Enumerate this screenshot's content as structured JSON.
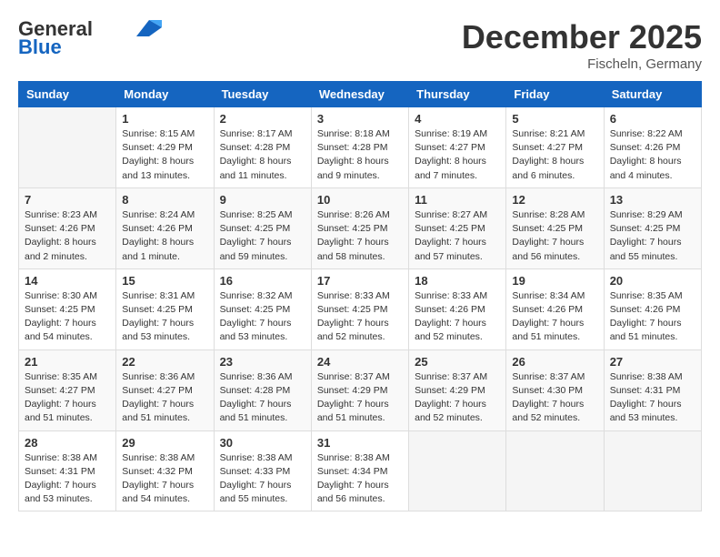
{
  "header": {
    "logo_general": "General",
    "logo_blue": "Blue",
    "month_title": "December 2025",
    "location": "Fischeln, Germany"
  },
  "weekdays": [
    "Sunday",
    "Monday",
    "Tuesday",
    "Wednesday",
    "Thursday",
    "Friday",
    "Saturday"
  ],
  "weeks": [
    [
      {
        "day": "",
        "info": ""
      },
      {
        "day": "1",
        "info": "Sunrise: 8:15 AM\nSunset: 4:29 PM\nDaylight: 8 hours\nand 13 minutes."
      },
      {
        "day": "2",
        "info": "Sunrise: 8:17 AM\nSunset: 4:28 PM\nDaylight: 8 hours\nand 11 minutes."
      },
      {
        "day": "3",
        "info": "Sunrise: 8:18 AM\nSunset: 4:28 PM\nDaylight: 8 hours\nand 9 minutes."
      },
      {
        "day": "4",
        "info": "Sunrise: 8:19 AM\nSunset: 4:27 PM\nDaylight: 8 hours\nand 7 minutes."
      },
      {
        "day": "5",
        "info": "Sunrise: 8:21 AM\nSunset: 4:27 PM\nDaylight: 8 hours\nand 6 minutes."
      },
      {
        "day": "6",
        "info": "Sunrise: 8:22 AM\nSunset: 4:26 PM\nDaylight: 8 hours\nand 4 minutes."
      }
    ],
    [
      {
        "day": "7",
        "info": "Sunrise: 8:23 AM\nSunset: 4:26 PM\nDaylight: 8 hours\nand 2 minutes."
      },
      {
        "day": "8",
        "info": "Sunrise: 8:24 AM\nSunset: 4:26 PM\nDaylight: 8 hours\nand 1 minute."
      },
      {
        "day": "9",
        "info": "Sunrise: 8:25 AM\nSunset: 4:25 PM\nDaylight: 7 hours\nand 59 minutes."
      },
      {
        "day": "10",
        "info": "Sunrise: 8:26 AM\nSunset: 4:25 PM\nDaylight: 7 hours\nand 58 minutes."
      },
      {
        "day": "11",
        "info": "Sunrise: 8:27 AM\nSunset: 4:25 PM\nDaylight: 7 hours\nand 57 minutes."
      },
      {
        "day": "12",
        "info": "Sunrise: 8:28 AM\nSunset: 4:25 PM\nDaylight: 7 hours\nand 56 minutes."
      },
      {
        "day": "13",
        "info": "Sunrise: 8:29 AM\nSunset: 4:25 PM\nDaylight: 7 hours\nand 55 minutes."
      }
    ],
    [
      {
        "day": "14",
        "info": "Sunrise: 8:30 AM\nSunset: 4:25 PM\nDaylight: 7 hours\nand 54 minutes."
      },
      {
        "day": "15",
        "info": "Sunrise: 8:31 AM\nSunset: 4:25 PM\nDaylight: 7 hours\nand 53 minutes."
      },
      {
        "day": "16",
        "info": "Sunrise: 8:32 AM\nSunset: 4:25 PM\nDaylight: 7 hours\nand 53 minutes."
      },
      {
        "day": "17",
        "info": "Sunrise: 8:33 AM\nSunset: 4:25 PM\nDaylight: 7 hours\nand 52 minutes."
      },
      {
        "day": "18",
        "info": "Sunrise: 8:33 AM\nSunset: 4:26 PM\nDaylight: 7 hours\nand 52 minutes."
      },
      {
        "day": "19",
        "info": "Sunrise: 8:34 AM\nSunset: 4:26 PM\nDaylight: 7 hours\nand 51 minutes."
      },
      {
        "day": "20",
        "info": "Sunrise: 8:35 AM\nSunset: 4:26 PM\nDaylight: 7 hours\nand 51 minutes."
      }
    ],
    [
      {
        "day": "21",
        "info": "Sunrise: 8:35 AM\nSunset: 4:27 PM\nDaylight: 7 hours\nand 51 minutes."
      },
      {
        "day": "22",
        "info": "Sunrise: 8:36 AM\nSunset: 4:27 PM\nDaylight: 7 hours\nand 51 minutes."
      },
      {
        "day": "23",
        "info": "Sunrise: 8:36 AM\nSunset: 4:28 PM\nDaylight: 7 hours\nand 51 minutes."
      },
      {
        "day": "24",
        "info": "Sunrise: 8:37 AM\nSunset: 4:29 PM\nDaylight: 7 hours\nand 51 minutes."
      },
      {
        "day": "25",
        "info": "Sunrise: 8:37 AM\nSunset: 4:29 PM\nDaylight: 7 hours\nand 52 minutes."
      },
      {
        "day": "26",
        "info": "Sunrise: 8:37 AM\nSunset: 4:30 PM\nDaylight: 7 hours\nand 52 minutes."
      },
      {
        "day": "27",
        "info": "Sunrise: 8:38 AM\nSunset: 4:31 PM\nDaylight: 7 hours\nand 53 minutes."
      }
    ],
    [
      {
        "day": "28",
        "info": "Sunrise: 8:38 AM\nSunset: 4:31 PM\nDaylight: 7 hours\nand 53 minutes."
      },
      {
        "day": "29",
        "info": "Sunrise: 8:38 AM\nSunset: 4:32 PM\nDaylight: 7 hours\nand 54 minutes."
      },
      {
        "day": "30",
        "info": "Sunrise: 8:38 AM\nSunset: 4:33 PM\nDaylight: 7 hours\nand 55 minutes."
      },
      {
        "day": "31",
        "info": "Sunrise: 8:38 AM\nSunset: 4:34 PM\nDaylight: 7 hours\nand 56 minutes."
      },
      {
        "day": "",
        "info": ""
      },
      {
        "day": "",
        "info": ""
      },
      {
        "day": "",
        "info": ""
      }
    ]
  ]
}
